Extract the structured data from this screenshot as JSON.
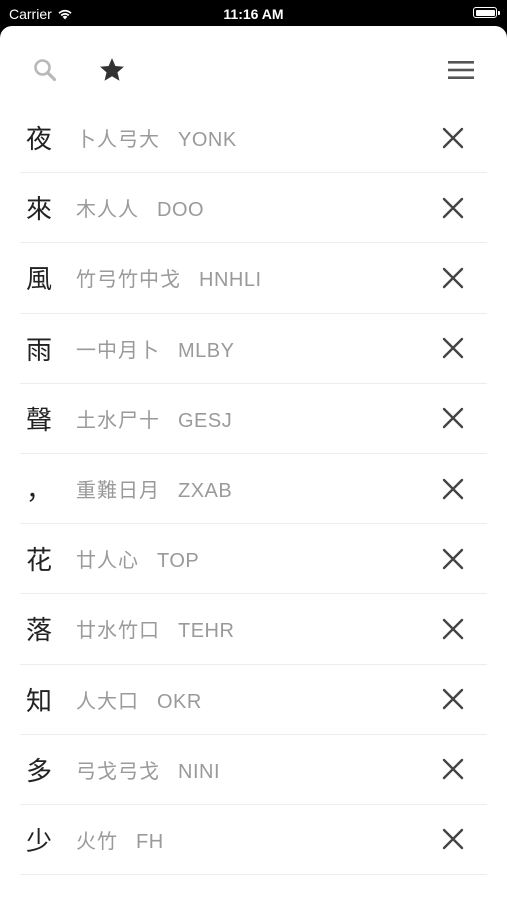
{
  "status_bar": {
    "carrier": "Carrier",
    "time": "11:16 AM"
  },
  "toolbar": {
    "search_icon": "search-icon",
    "star_icon": "star-icon",
    "menu_icon": "hamburger-menu-icon"
  },
  "colors": {
    "char_text": "#222222",
    "code_text": "#9a9a9a",
    "icon_gray": "#b8b8b8",
    "icon_dark": "#333333"
  },
  "items": [
    {
      "char": "夜",
      "radicals": "卜人弓大",
      "code": "YONK"
    },
    {
      "char": "來",
      "radicals": "木人人",
      "code": "DOO"
    },
    {
      "char": "風",
      "radicals": "竹弓竹中戈",
      "code": "HNHLI"
    },
    {
      "char": "雨",
      "radicals": "一中月卜",
      "code": "MLBY"
    },
    {
      "char": "聲",
      "radicals": "土水尸十",
      "code": "GESJ"
    },
    {
      "char": "，",
      "radicals": "重難日月",
      "code": "ZXAB"
    },
    {
      "char": "花",
      "radicals": "廿人心",
      "code": "TOP"
    },
    {
      "char": "落",
      "radicals": "廿水竹口",
      "code": "TEHR"
    },
    {
      "char": "知",
      "radicals": "人大口",
      "code": "OKR"
    },
    {
      "char": "多",
      "radicals": "弓戈弓戈",
      "code": "NINI"
    },
    {
      "char": "少",
      "radicals": "火竹",
      "code": "FH"
    }
  ]
}
